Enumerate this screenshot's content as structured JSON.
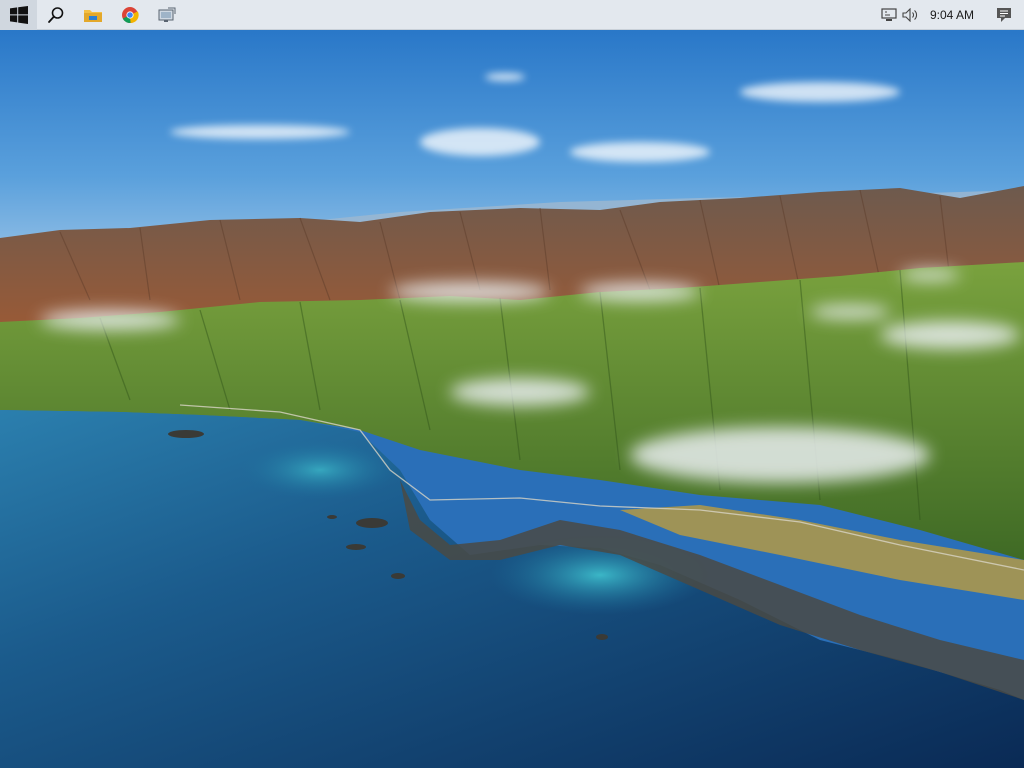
{
  "taskbar": {
    "start_icon": "windows-logo-icon",
    "pinned": [
      {
        "name": "search-icon"
      },
      {
        "name": "file-explorer-icon"
      },
      {
        "name": "chrome-icon"
      },
      {
        "name": "remote-desktop-icon"
      }
    ],
    "tray": {
      "icons": [
        "network-icon",
        "volume-icon"
      ],
      "clock": "9:04 AM",
      "notifications_icon": "action-center-icon"
    },
    "colors": {
      "background": "#e3e8ee",
      "text": "#1a1a1a"
    }
  },
  "wallpaper": {
    "scene": "coastal-mountains",
    "colors": {
      "sky": "#3d87cc",
      "ocean": "#0f3c6e",
      "hills": "#4f7f2c",
      "mountains": "#8a5a3e"
    }
  }
}
